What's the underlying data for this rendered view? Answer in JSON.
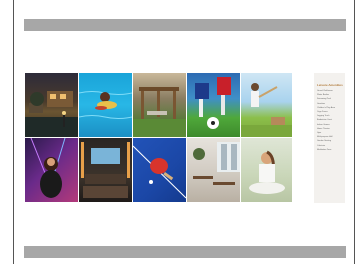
{
  "legend": {
    "title": "Leisure Amenities",
    "items": [
      "Grand Clubhouse",
      "Water Bodies",
      "Swimming Pool",
      "Gazebos",
      "Children's Play Area",
      "Yoga Zones",
      "Jogging Track",
      "Badminton Court",
      "Indoor Games",
      "Home Theatre",
      "Gym",
      "Multipurpose Hall",
      "Garden Seating",
      "Cafeteria",
      "Meditation Zone"
    ]
  },
  "colors": {
    "gray_bar": "#a7a7a7",
    "legend_title": "#b07a3a",
    "legend_bg": "#f3f1ee"
  }
}
